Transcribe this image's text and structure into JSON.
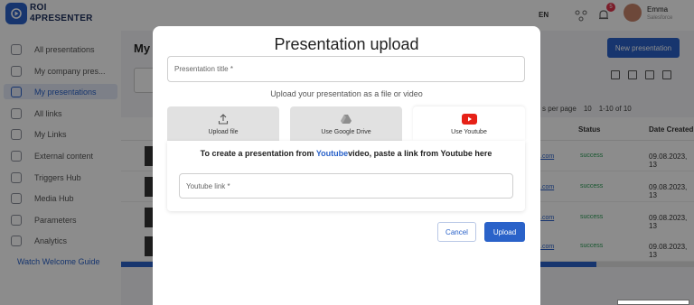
{
  "app": {
    "logo_line1": "ROI",
    "logo_line2": "4PRESENTER",
    "language": "EN",
    "notification_count": "5",
    "user_name": "Emma",
    "user_role": "Salesforce"
  },
  "sidebar": {
    "items": [
      {
        "label": "All presentations",
        "active": false,
        "icon": "presentation-icon"
      },
      {
        "label": "My company pres...",
        "active": false,
        "icon": "company-icon"
      },
      {
        "label": "My presentations",
        "active": true,
        "icon": "presentation-icon"
      },
      {
        "label": "All links",
        "active": false,
        "icon": "link-icon"
      },
      {
        "label": "My Links",
        "active": false,
        "icon": "link-icon"
      },
      {
        "label": "External content",
        "active": false,
        "icon": "document-icon"
      },
      {
        "label": "Triggers Hub",
        "active": false,
        "icon": "lightning-icon"
      },
      {
        "label": "Media Hub",
        "active": false,
        "icon": "image-icon"
      },
      {
        "label": "Parameters",
        "active": false,
        "icon": "sliders-icon"
      },
      {
        "label": "Analytics",
        "active": false,
        "icon": "chart-icon"
      }
    ],
    "welcome_guide": "Watch Welcome Guide"
  },
  "main": {
    "title": "My p",
    "new_button": "New presentation",
    "pager_label": "s per page",
    "pager_value": "10",
    "pager_range": "1-10 of 10",
    "col_status": "Status",
    "col_date": "Date Created",
    "rows": [
      {
        "link": ".com",
        "status": "success",
        "date": "09.08.2023, 13"
      },
      {
        "link": ".com",
        "status": "success",
        "date": "09.08.2023, 13"
      },
      {
        "link": ".com",
        "status": "success",
        "date": "09.08.2023, 13"
      },
      {
        "link": ".com",
        "status": "success",
        "date": "09.08.2023, 13"
      }
    ],
    "scroll_progress": 0.83
  },
  "modal": {
    "title": "Presentation upload",
    "title_placeholder": "Presentation title *",
    "upload_hint": "Upload your presentation as a file or video",
    "tabs": [
      {
        "label": "Upload file",
        "icon": "upload-icon",
        "active": false
      },
      {
        "label": "Use Google Drive",
        "icon": "google-drive-icon",
        "active": false
      },
      {
        "label": "Use Youtube",
        "icon": "youtube-icon",
        "active": true
      }
    ],
    "panel_text_before": "To create a presentation from ",
    "panel_text_link": "Youtube",
    "panel_text_after": "video, paste a link from Youtube here",
    "youtube_placeholder": "Youtube link *",
    "cancel_label": "Cancel",
    "upload_label": "Upload"
  },
  "colors": {
    "accent": "#2a62c9",
    "success": "#2a9d55",
    "badge": "#e0344b",
    "youtube": "#e62117"
  }
}
